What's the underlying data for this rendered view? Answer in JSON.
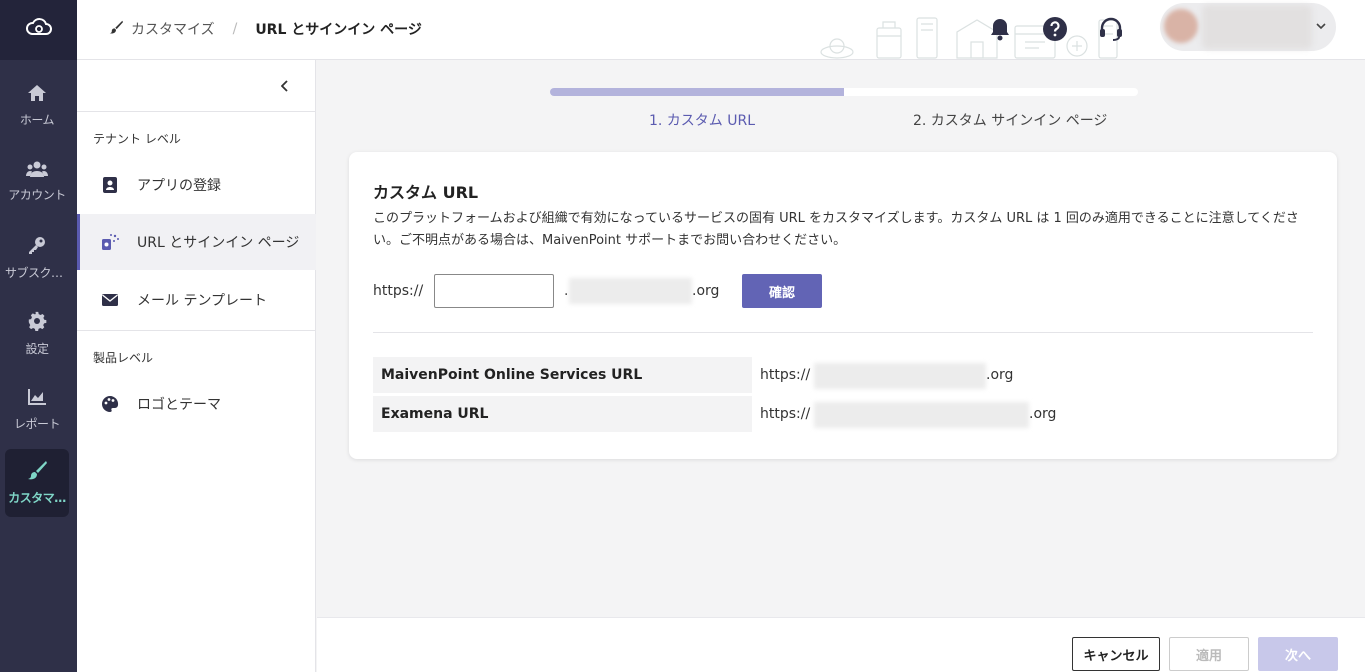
{
  "rail": {
    "items": [
      {
        "label": "ホーム",
        "icon": "home-icon"
      },
      {
        "label": "アカウント",
        "icon": "users-icon"
      },
      {
        "label": "サブスクリ…",
        "icon": "key-icon"
      },
      {
        "label": "設定",
        "icon": "gear-icon"
      },
      {
        "label": "レポート",
        "icon": "chart-icon"
      },
      {
        "label": "カスタマ…",
        "icon": "brush-icon",
        "active": true
      }
    ]
  },
  "header": {
    "breadcrumb_parent": "カスタマイズ",
    "breadcrumb_separator": "/",
    "breadcrumb_current": "URL とサインイン ページ"
  },
  "subnav": {
    "group_tenant": "テナント レベル",
    "group_product": "製品レベル",
    "items": [
      {
        "label": "アプリの登録",
        "icon": "app-register-icon"
      },
      {
        "label": "URL とサインイン ページ",
        "icon": "url-signin-icon",
        "active": true
      },
      {
        "label": "メール テンプレート",
        "icon": "mail-icon"
      },
      {
        "label": "ロゴとテーマ",
        "icon": "palette-icon"
      }
    ]
  },
  "stepper": {
    "progress": 0.5,
    "step1": "1. カスタム URL",
    "step2": "2. カスタム サインイン ページ"
  },
  "card": {
    "title": "カスタム URL",
    "description": "このプラットフォームおよび組織で有効になっているサービスの固有 URL をカスタマイズします。カスタム URL は 1 回のみ適用できることに注意してください。ご不明点がある場合は、MaivenPoint サポートまでお問い合わせください。",
    "url_prefix": "https://",
    "url_input_value": "",
    "url_dot": ".",
    "url_suffix": ".org",
    "confirm_label": "確認",
    "rows": [
      {
        "label": "MaivenPoint Online Services URL",
        "prefix": "https://",
        "suffix": ".org"
      },
      {
        "label": "Examena URL",
        "prefix": "https://",
        "suffix": ".org"
      }
    ]
  },
  "footer": {
    "cancel_label": "キャンセル",
    "apply_label": "適用",
    "next_label": "次へ"
  },
  "colors": {
    "rail_bg": "#2f3048",
    "accent": "#6264b5",
    "active_rail_text": "#7fd6c7",
    "step_active": "#5b5bb0"
  }
}
